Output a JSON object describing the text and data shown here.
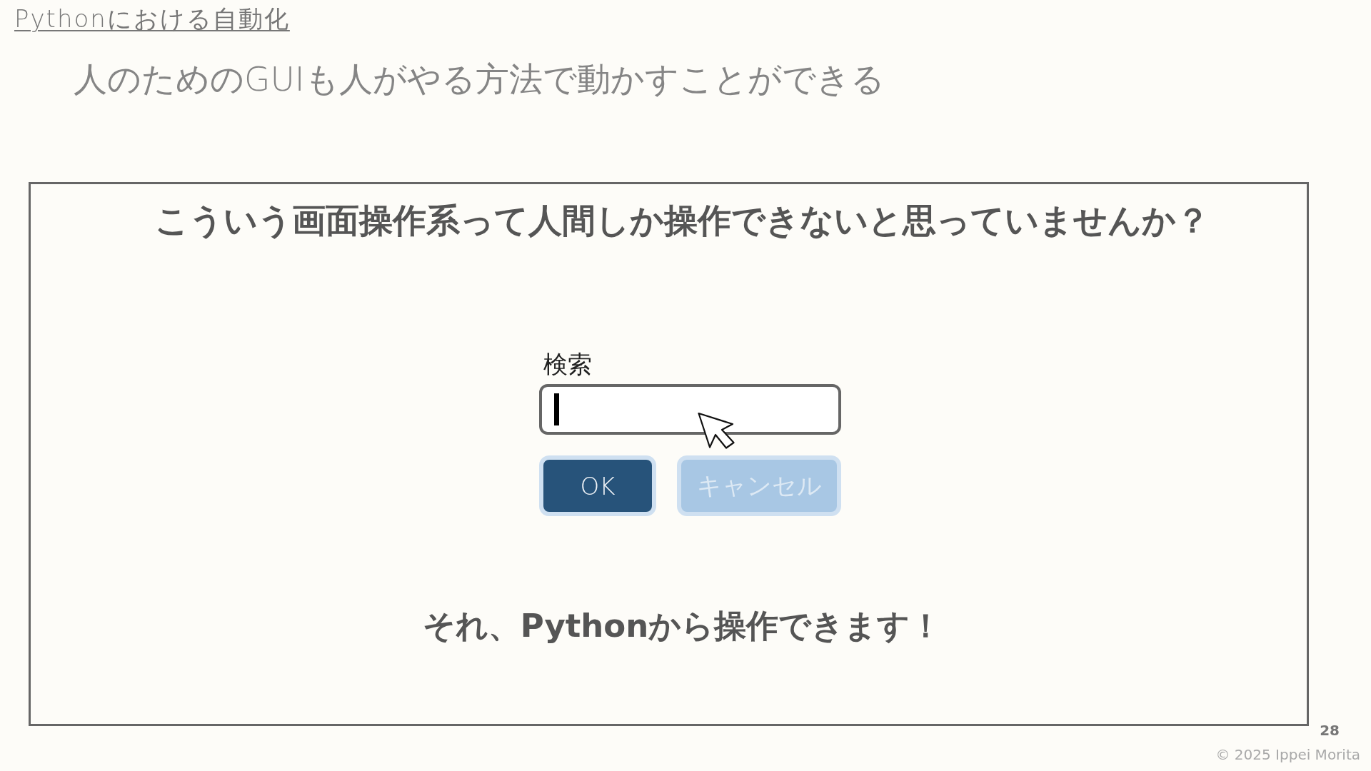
{
  "header": {
    "section_title": "Pythonにおける自動化",
    "subtitle": "人のためのGUIも人がやる方法で動かすことができる"
  },
  "panel": {
    "question": "こういう画面操作系って人間しか操作できないと思っていませんか？",
    "dialog": {
      "field_label": "検索",
      "search_field": {
        "focused": true
      },
      "buttons": [
        {
          "label": "OK",
          "disabled": false
        },
        {
          "label": "キャンセル",
          "disabled": true
        }
      ]
    },
    "answer": "それ、Pythonから操作できます！"
  },
  "footer": {
    "page_number": "28",
    "copyright": "© 2025 Ippei Morita"
  }
}
